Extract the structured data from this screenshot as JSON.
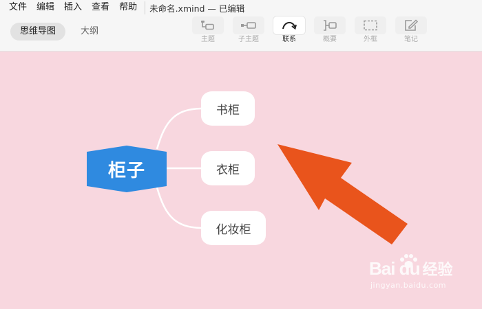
{
  "menu": [
    "文件",
    "编辑",
    "插入",
    "查看",
    "帮助"
  ],
  "document": {
    "title": "未命名.xmind — 已编辑"
  },
  "view_tabs": {
    "mindmap": "思维导图",
    "outline": "大纲"
  },
  "toolbar": {
    "topic": "主题",
    "subtopic": "子主题",
    "relationship": "联系",
    "summary": "概要",
    "boundary": "外框",
    "note": "笔记"
  },
  "mindmap": {
    "root": "柜子",
    "children": [
      "书柜",
      "衣柜",
      "化妆柜"
    ]
  },
  "watermark": {
    "brand": "Bai du",
    "product": "经验",
    "url": "jingyan.baidu.com"
  },
  "colors": {
    "canvas_bg": "#f8d7df",
    "root_fill": "#2f8ae0",
    "arrow": "#e9541c",
    "connector": "#ffffff"
  },
  "icons": {
    "topic": "topic-icon",
    "subtopic": "subtopic-icon",
    "relationship": "relationship-curve-icon",
    "summary": "summary-brace-icon",
    "boundary": "boundary-dashed-icon",
    "note": "note-pencil-icon",
    "arrow": "arrow-pointer-icon",
    "paw": "paw-logo-icon"
  }
}
